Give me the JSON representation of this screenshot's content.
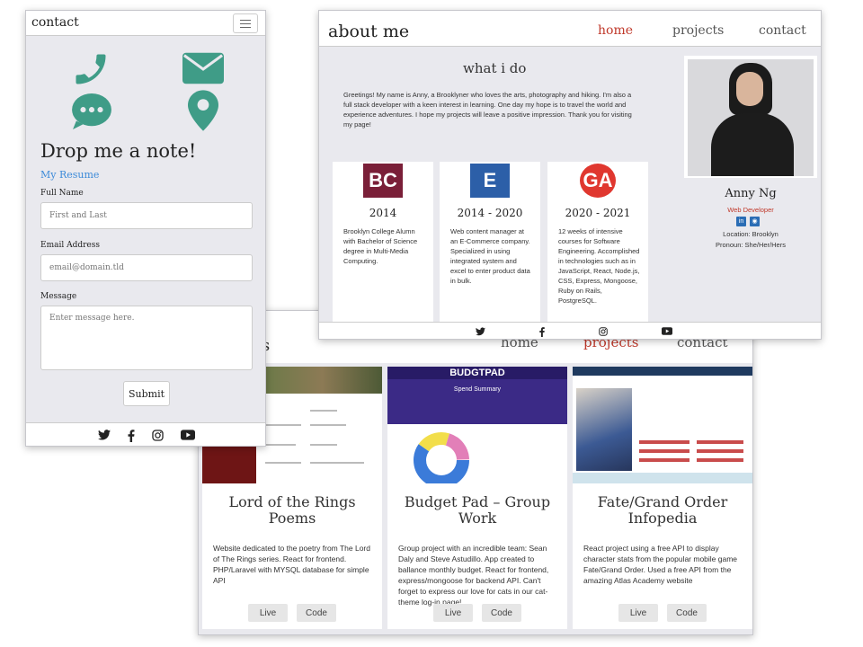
{
  "colors": {
    "accent_red": "#c0392b",
    "contact_green": "#3f9c87",
    "link_blue": "#3d8bd9"
  },
  "projects_window": {
    "brand_fragment": "s",
    "nav": [
      "home",
      "projects",
      "contact"
    ],
    "active": "projects",
    "cards": [
      {
        "title": "Lord of the Rings Poems",
        "description": "Website dedicated to the poetry from The Lord of The Rings series. React for frontend. PHP/Laravel with MYSQL database for simple API",
        "live_label": "Live",
        "code_label": "Code"
      },
      {
        "title": "Budget Pad – Group Work",
        "description": "Group project with an incredible team: Sean Daly and Steve Astudillo. App created to ballance monthly budget. React for frontend, express/mongoose for backend API. Can't forget to express our love for cats in our cat-theme log-in page!",
        "live_label": "Live",
        "code_label": "Code",
        "thumb": {
          "header": "BUDGTPAD",
          "subheader": "Spend Summary"
        }
      },
      {
        "title": "Fate/Grand Order Infopedia",
        "description": "React project using a free API to display character stats from the popular mobile game Fate/Grand Order. Used a free API from the amazing Atlas Academy website",
        "live_label": "Live",
        "code_label": "Code"
      }
    ]
  },
  "about_window": {
    "brand": "about me",
    "nav": [
      "home",
      "projects",
      "contact"
    ],
    "active": "home",
    "heading": "what i do",
    "intro": "Greetings! My name is Anny, a Brooklyner who loves the arts, photography and hiking. I'm also a full stack developer with a keen interest in learning. One day my hope is to travel the world and experience adventures. I hope my projects will leave a positive impression. Thank you for visiting my page!",
    "cards": [
      {
        "logo": "BC",
        "logo_color": "#7a1f38",
        "year": "2014",
        "text": "Brooklyn College Alumn with Bachelor of Science degree in Multi-Media Computing."
      },
      {
        "logo": "E",
        "logo_color": "#2c5fa8",
        "year": "2014 - 2020",
        "text": "Web content manager at an E-Commerce company. Specialized in using integrated system and excel to enter product data in bulk."
      },
      {
        "logo": "GA",
        "logo_color": "#e0372f",
        "year": "2020 - 2021",
        "text": "12 weeks of intensive courses for Software Engineering. Accomplished in technologies such as in JavaScript, React, Node.js, CSS, Express, Mongoose, Ruby on Rails, PostgreSQL."
      }
    ],
    "profile": {
      "name": "Anny Ng",
      "role": "Web Developer",
      "location": "Location: Brooklyn",
      "pronoun": "Pronoun: She/Her/Hers"
    }
  },
  "contact_window": {
    "brand": "contact",
    "title": "Drop me a note!",
    "resume_link": "My Resume",
    "full_name_label": "Full Name",
    "full_name_placeholder": "First and Last",
    "email_label": "Email Address",
    "email_placeholder": "email@domain.tld",
    "message_label": "Message",
    "message_placeholder": "Enter message here.",
    "submit_label": "Submit"
  },
  "footer_icons": [
    "twitter-icon",
    "facebook-icon",
    "instagram-icon",
    "youtube-icon"
  ]
}
